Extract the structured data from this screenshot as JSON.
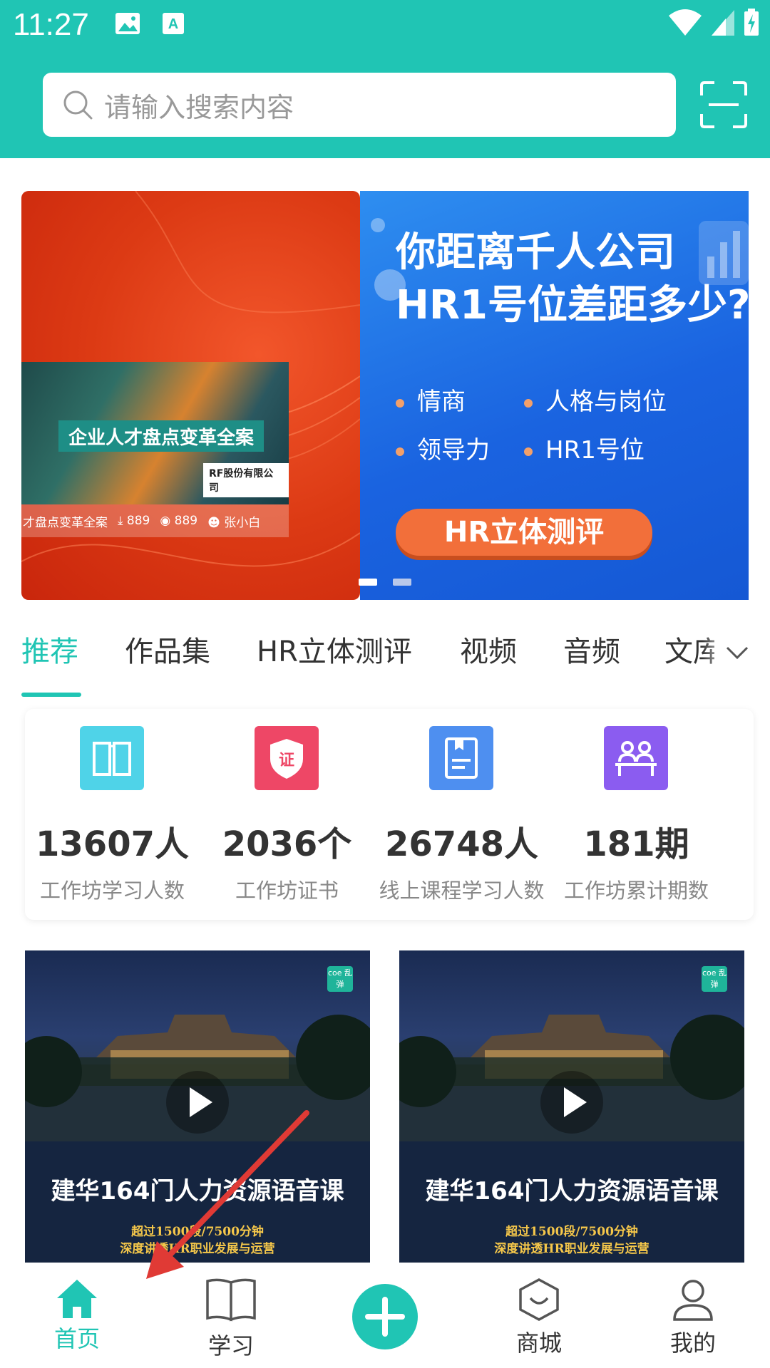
{
  "status_bar": {
    "time": "11:27"
  },
  "search": {
    "placeholder": "请输入搜索内容"
  },
  "banner": {
    "left": {
      "card_title": "企业人才盘点变革全案",
      "card_badge": "RF股份有限公司",
      "meta_title": "才盘点变革全案",
      "downloads": "889",
      "views": "889",
      "author": "张小白"
    },
    "right": {
      "headline_line1": "你距离千人公司",
      "headline_line2": "HR1号位差距多少?",
      "bullets": [
        "情商",
        "人格与岗位",
        "领导力",
        "HR1号位"
      ],
      "button": "HR立体测评"
    }
  },
  "tabs": {
    "items": [
      "推荐",
      "作品集",
      "HR立体测评",
      "视频",
      "音频",
      "文库"
    ],
    "active_index": 0
  },
  "stats": [
    {
      "value": "13607人",
      "label": "工作坊学习人数",
      "icon": "book-icon",
      "color": "#4fd3e8"
    },
    {
      "value": "2036个",
      "label": "工作坊证书",
      "icon": "certificate-shield-icon",
      "color": "#ee4766"
    },
    {
      "value": "26748人",
      "label": "线上课程学习人数",
      "icon": "document-icon",
      "color": "#4e8ff0"
    },
    {
      "value": "181期",
      "label": "工作坊累计期数",
      "icon": "classroom-icon",
      "color": "#8b5cf0"
    }
  ],
  "courses": [
    {
      "title": "建华164门人力资源语音课",
      "sub1": "超过1500段/7500分钟",
      "sub2": "深度讲透HR职业发展与运营",
      "brand": "coe 乱弹"
    },
    {
      "title": "建华164门人力资源语音课",
      "sub1": "超过1500段/7500分钟",
      "sub2": "深度讲透HR职业发展与运营",
      "brand": "coe 乱弹"
    }
  ],
  "nav": {
    "home": "首页",
    "learn": "学习",
    "mall": "商城",
    "mine": "我的"
  },
  "colors": {
    "accent": "#20c5b4",
    "annotation_arrow": "#e03a35"
  }
}
